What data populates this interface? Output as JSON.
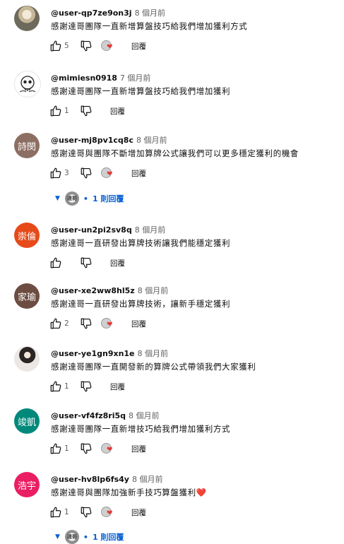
{
  "labels": {
    "reply": "回覆",
    "hearted_heart": "❤"
  },
  "colors": {
    "link_blue": "#065fd4",
    "heart_red": "#e53935",
    "avatar_shiren": "#8d6e63",
    "avatar_chonglun": "#e64a19",
    "avatar_jiayu": "#6d4c41",
    "avatar_junkai": "#00897b",
    "avatar_haoyu": "#e91e63"
  },
  "comments": [
    {
      "username": "@user-qp7ze9on3j",
      "time": "8 個月前",
      "text": "感謝達哥團隊一直新增算盤技巧給我們增加獲利方式",
      "likes": "5",
      "avatar_text": ""
    },
    {
      "username": "@mimiesn0918",
      "time": "7 個月前",
      "text": "感謝達哥團隊一直新增算盤技巧給我們增加獲利",
      "likes": "1",
      "avatar_text": ""
    },
    {
      "username": "@user-mj8pv1cq8c",
      "time": "8 個月前",
      "text": "感謝達哥與團隊不斷增加算牌公式讓我們可以更多穩定獲利的機會",
      "likes": "3",
      "avatar_text": "詩閔",
      "replies": "1 則回覆",
      "reply_avatar_text": "達哥"
    },
    {
      "username": "@user-un2pi2sv8q",
      "time": "8 個月前",
      "text": "感謝達哥一直研發出算牌技術讓我們能穩定獲利",
      "likes": "",
      "avatar_text": "崇倫"
    },
    {
      "username": "@user-xe2ww8hl5z",
      "time": "8 個月前",
      "text": "感謝達哥一直研發出算牌技術，讓新手穩定獲利",
      "likes": "2",
      "avatar_text": "家瑜"
    },
    {
      "username": "@user-ye1gn9xn1e",
      "time": "8 個月前",
      "text": "感謝達哥團隊一直開發新的算牌公式帶領我們大家獲利",
      "likes": "1",
      "avatar_text": ""
    },
    {
      "username": "@user-vf4fz8ri5q",
      "time": "8 個月前",
      "text": "感謝達哥團隊一直新增技巧給我們增加獲利方式",
      "likes": "1",
      "avatar_text": "竣凱"
    },
    {
      "username": "@user-hv8lp6fs4y",
      "time": "8 個月前",
      "text": "感謝達哥與團隊加強新手技巧算盤獲利",
      "text_heart": "❤️",
      "likes": "1",
      "avatar_text": "浩宇",
      "replies": "1 則回覆",
      "reply_avatar_text": "達哥"
    }
  ]
}
